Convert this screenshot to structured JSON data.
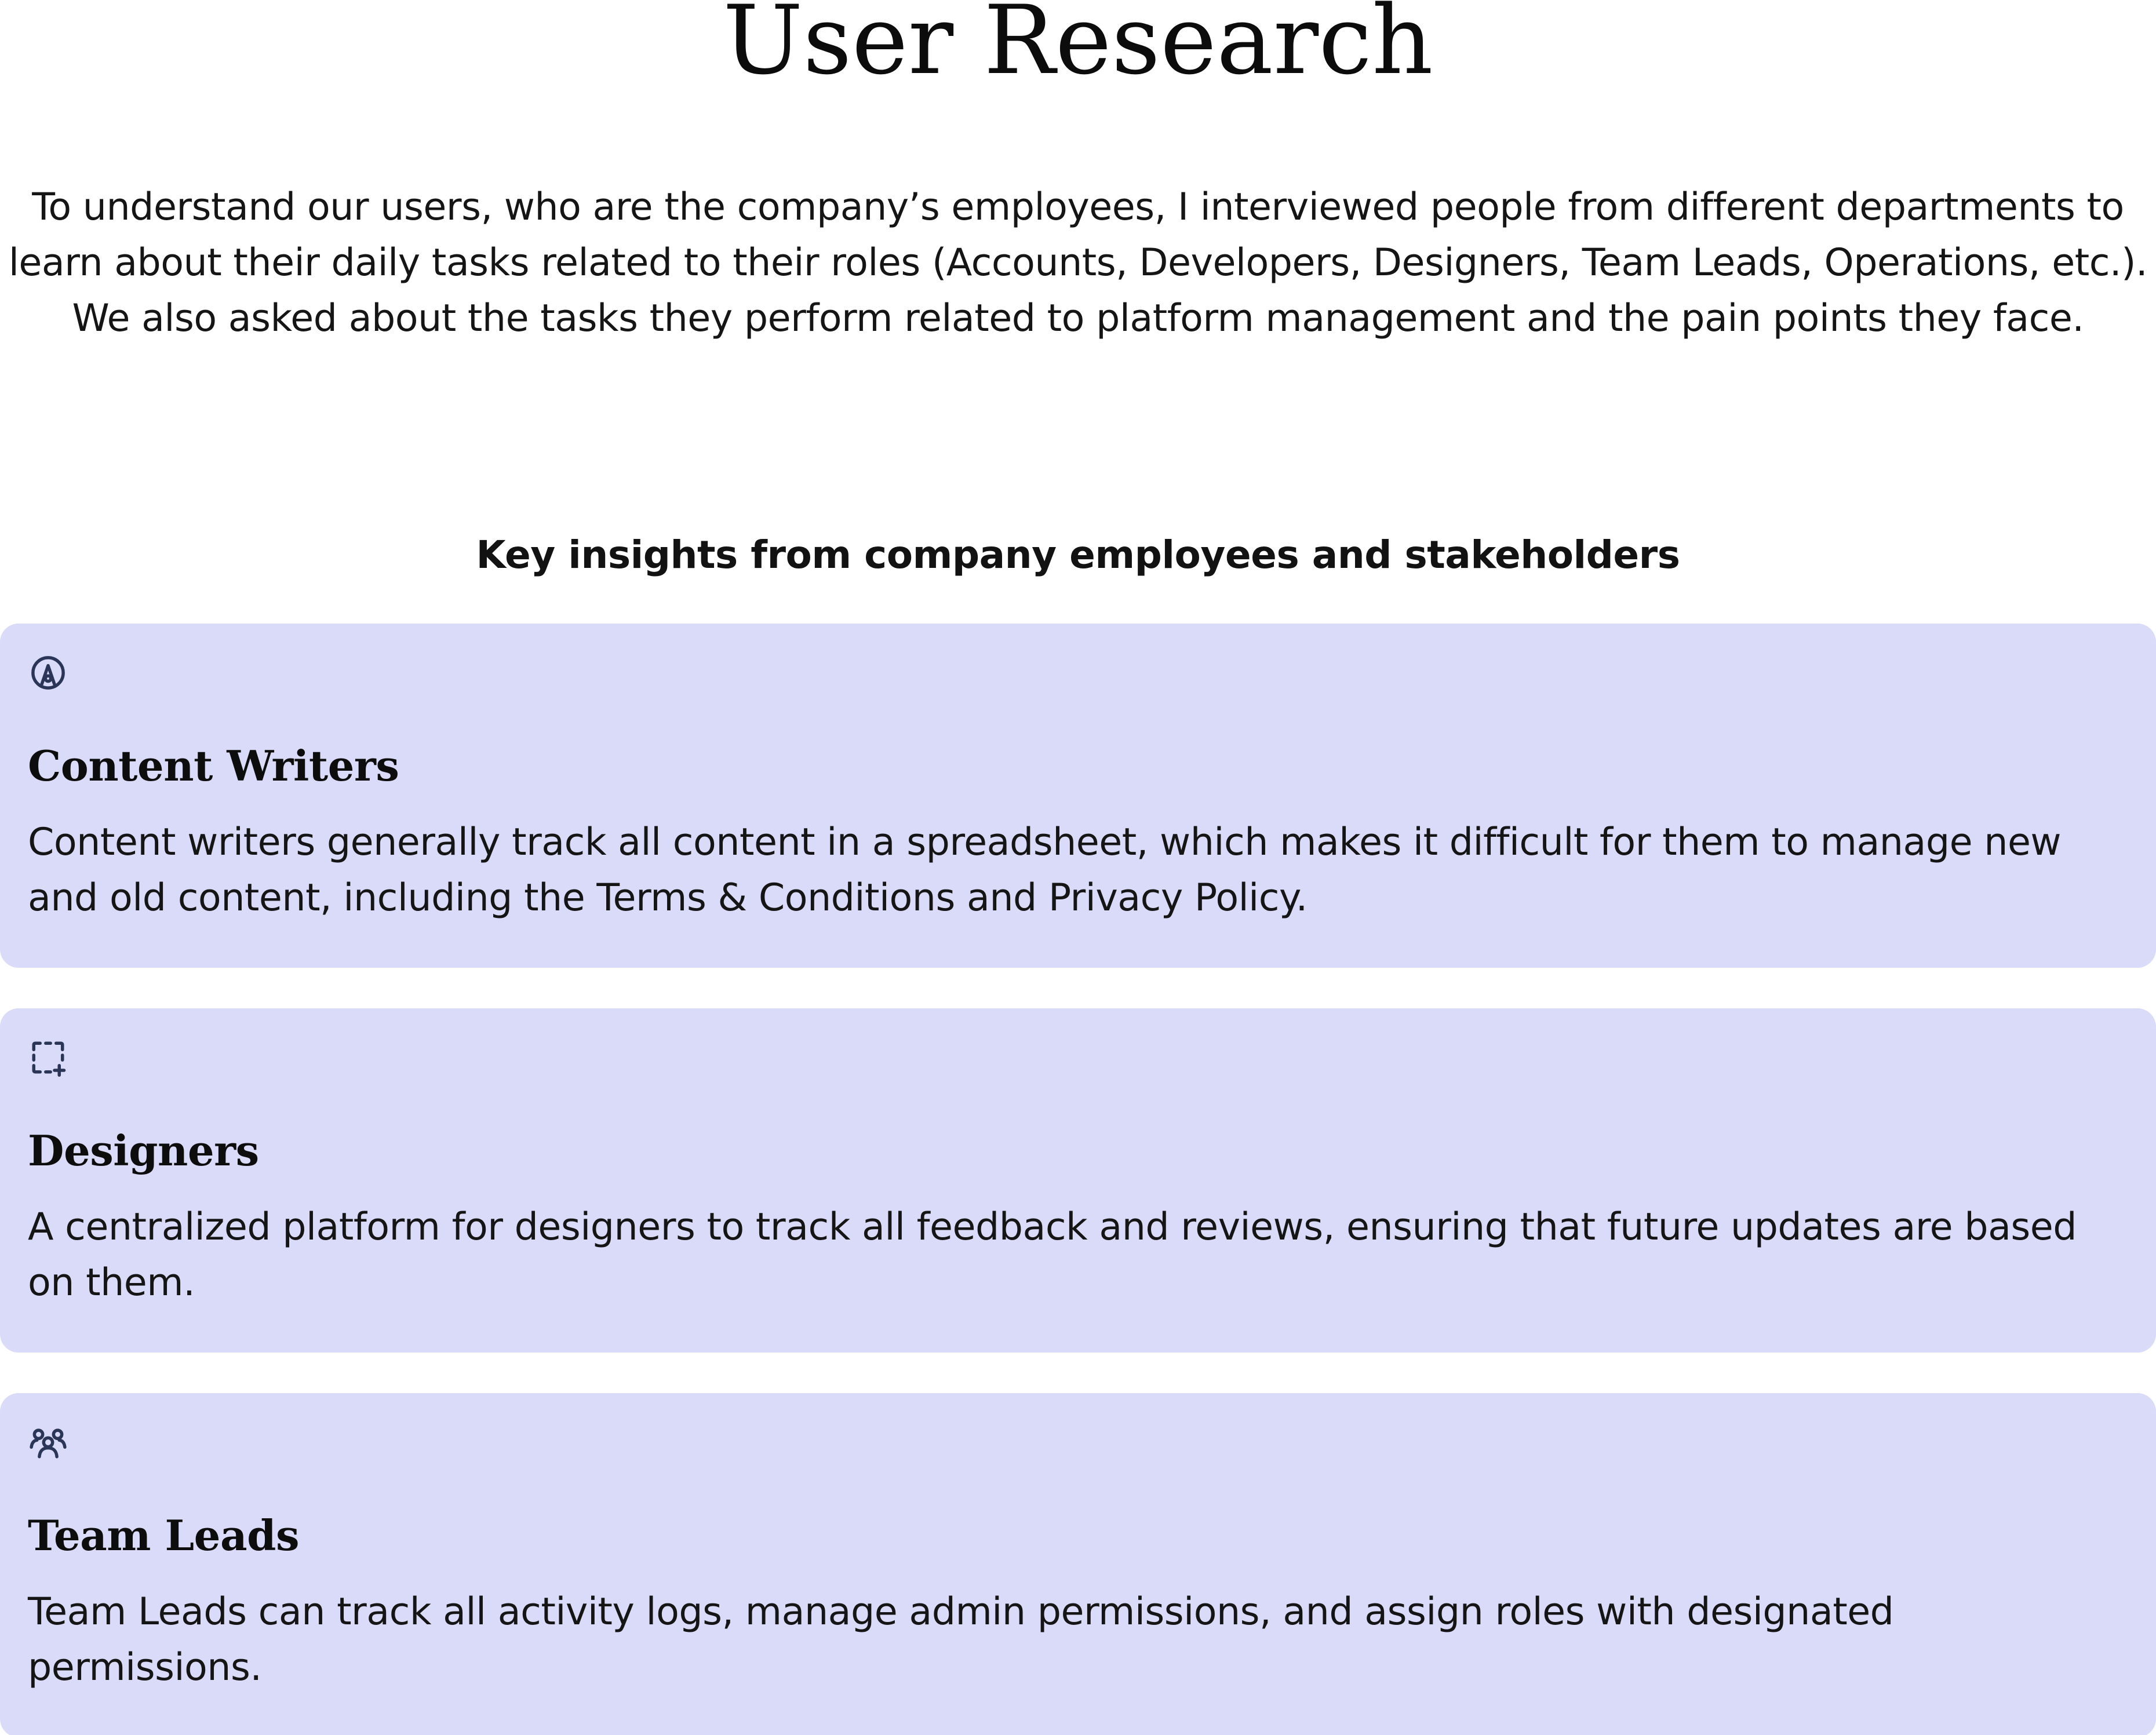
{
  "header": {
    "title": "User Research",
    "intro": "To understand our users, who are the company’s employees, I interviewed people from different departments to learn about their daily tasks related to their roles (Accounts, Developers, Designers, Team Leads, Operations, etc.). We also asked about the tasks they perform related to platform management and the pain points they face."
  },
  "insights": {
    "heading": "Key insights from company employees and stakeholders",
    "cards": [
      {
        "icon": "pen-tool-icon",
        "title": "Content Writers",
        "body": "Content writers generally track all content in a spreadsheet, which makes it difficult for them to manage new and old content, including the Terms & Conditions and Privacy Policy."
      },
      {
        "icon": "dashed-frame-add-icon",
        "title": "Designers",
        "body": "A centralized platform for designers to track all feedback and reviews, ensuring that future updates are based on them."
      },
      {
        "icon": "user-group-icon",
        "title": "Team Leads",
        "body": "Team Leads can track all activity logs, manage admin permissions, and assign roles with designated permissions."
      }
    ]
  },
  "colors": {
    "card_background": "#d9dbf8",
    "icon_color": "#2b3557",
    "text": "#151515"
  }
}
